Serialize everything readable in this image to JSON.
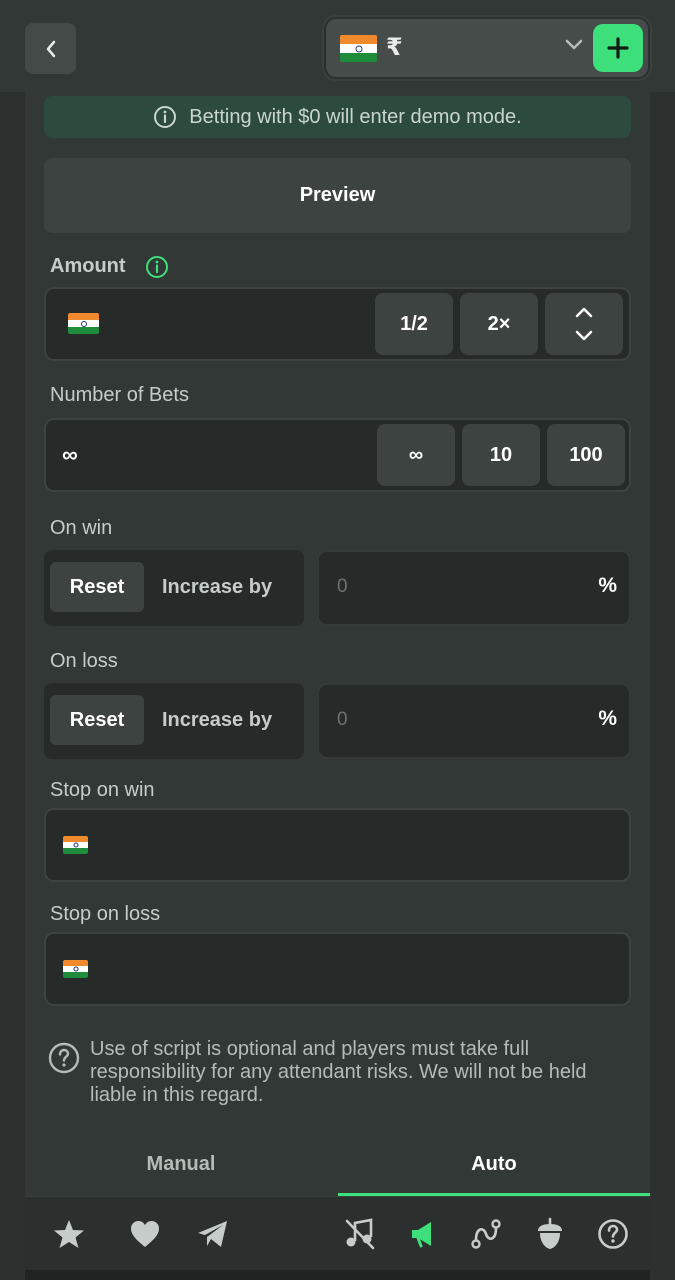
{
  "header": {
    "currency_symbol": "₹",
    "flag_icon": "india-flag-icon",
    "accent_color": "#3ee07c"
  },
  "demo_notice": "Betting with $0 will enter demo mode.",
  "preview_label": "Preview",
  "amount": {
    "label": "Amount",
    "half_label": "1/2",
    "double_label": "2×"
  },
  "number_of_bets": {
    "label": "Number of Bets",
    "value": "∞",
    "presets": [
      "∞",
      "10",
      "100"
    ]
  },
  "on_win": {
    "label": "On win",
    "reset_label": "Reset",
    "increase_label": "Increase by",
    "value": "0",
    "unit": "%"
  },
  "on_loss": {
    "label": "On loss",
    "reset_label": "Reset",
    "increase_label": "Increase by",
    "value": "0",
    "unit": "%"
  },
  "stop_on_win": {
    "label": "Stop on win"
  },
  "stop_on_loss": {
    "label": "Stop on loss"
  },
  "disclaimer": "Use of script is optional and players must take full responsibility for any attendant risks. We will not be held liable in this regard.",
  "tabs": [
    {
      "label": "Manual",
      "active": false
    },
    {
      "label": "Auto",
      "active": true
    }
  ],
  "bottom_nav": {
    "icons": [
      "star-icon",
      "heart-icon",
      "telegram-icon",
      "music-off-icon",
      "sound-icon",
      "route-icon",
      "acorn-icon",
      "help-icon"
    ]
  }
}
